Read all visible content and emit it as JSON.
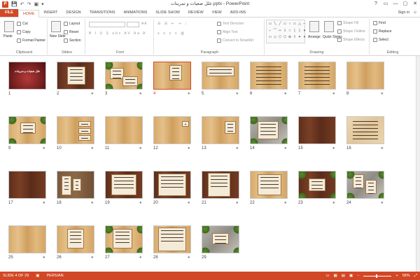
{
  "window": {
    "title": "علل ضعیات و تمرینات.pptx - PowerPoint",
    "controls": [
      "?",
      "▭",
      "—",
      "▢",
      "✕"
    ]
  },
  "qat": {
    "save": "💾",
    "undo": "↶",
    "redo": "↷",
    "present": "▣",
    "customize": "▾"
  },
  "tabs": [
    "FILE",
    "HOME",
    "INSERT",
    "DESIGN",
    "TRANSITIONS",
    "ANIMATIONS",
    "SLIDE SHOW",
    "REVIEW",
    "VIEW",
    "ADD-INS"
  ],
  "active_tab": "HOME",
  "signin": "Sign in",
  "ribbon": {
    "clipboard": {
      "label": "Clipboard",
      "paste": "Paste",
      "cut": "Cut",
      "copy": "Copy",
      "format_painter": "Format Painter"
    },
    "slides": {
      "label": "Slides",
      "new_slide": "New Slide",
      "layout": "Layout",
      "reset": "Reset",
      "section": "Section"
    },
    "font": {
      "label": "Font"
    },
    "paragraph": {
      "label": "Paragraph",
      "text_direction": "Text Direction",
      "align_text": "Align Text",
      "convert": "Convert to SmartArt"
    },
    "drawing": {
      "label": "Drawing",
      "arrange": "Arrange",
      "quick_styles": "Quick Styles",
      "shape_fill": "Shape Fill",
      "shape_outline": "Shape Outline",
      "shape_effects": "Shape Effects"
    },
    "editing": {
      "label": "Editing",
      "find": "Find",
      "replace": "Replace",
      "select": "Select"
    }
  },
  "slides": [
    {
      "n": "1",
      "star": ""
    },
    {
      "n": "2",
      "star": "★"
    },
    {
      "n": "3",
      "star": "★"
    },
    {
      "n": "4",
      "star": "★"
    },
    {
      "n": "5",
      "star": "★"
    },
    {
      "n": "6",
      "star": "★"
    },
    {
      "n": "7",
      "star": "★"
    },
    {
      "n": "8",
      "star": "★"
    },
    {
      "n": "9",
      "star": "★"
    },
    {
      "n": "10",
      "star": "★"
    },
    {
      "n": "11",
      "star": "★"
    },
    {
      "n": "12",
      "star": "★"
    },
    {
      "n": "13",
      "star": "★"
    },
    {
      "n": "14",
      "star": "★"
    },
    {
      "n": "15",
      "star": "★"
    },
    {
      "n": "16",
      "star": "★"
    },
    {
      "n": "17",
      "star": "★"
    },
    {
      "n": "18",
      "star": "★"
    },
    {
      "n": "19",
      "star": "★"
    },
    {
      "n": "20",
      "star": "★"
    },
    {
      "n": "21",
      "star": "★"
    },
    {
      "n": "22",
      "star": "★"
    },
    {
      "n": "23",
      "star": "★"
    },
    {
      "n": "24",
      "star": "★"
    },
    {
      "n": "25",
      "star": "★"
    },
    {
      "n": "26",
      "star": "★"
    },
    {
      "n": "27",
      "star": "★"
    },
    {
      "n": "28",
      "star": "★"
    },
    {
      "n": "29",
      "star": ""
    }
  ],
  "selected_slide": "4",
  "slide1_title": "علل ضعیات و تمرینات",
  "status": {
    "slide_of": "SLIDE 4 OF 29",
    "language": "PERSIAN",
    "zoom": "58%"
  },
  "colors": {
    "accent": "#d24726"
  }
}
